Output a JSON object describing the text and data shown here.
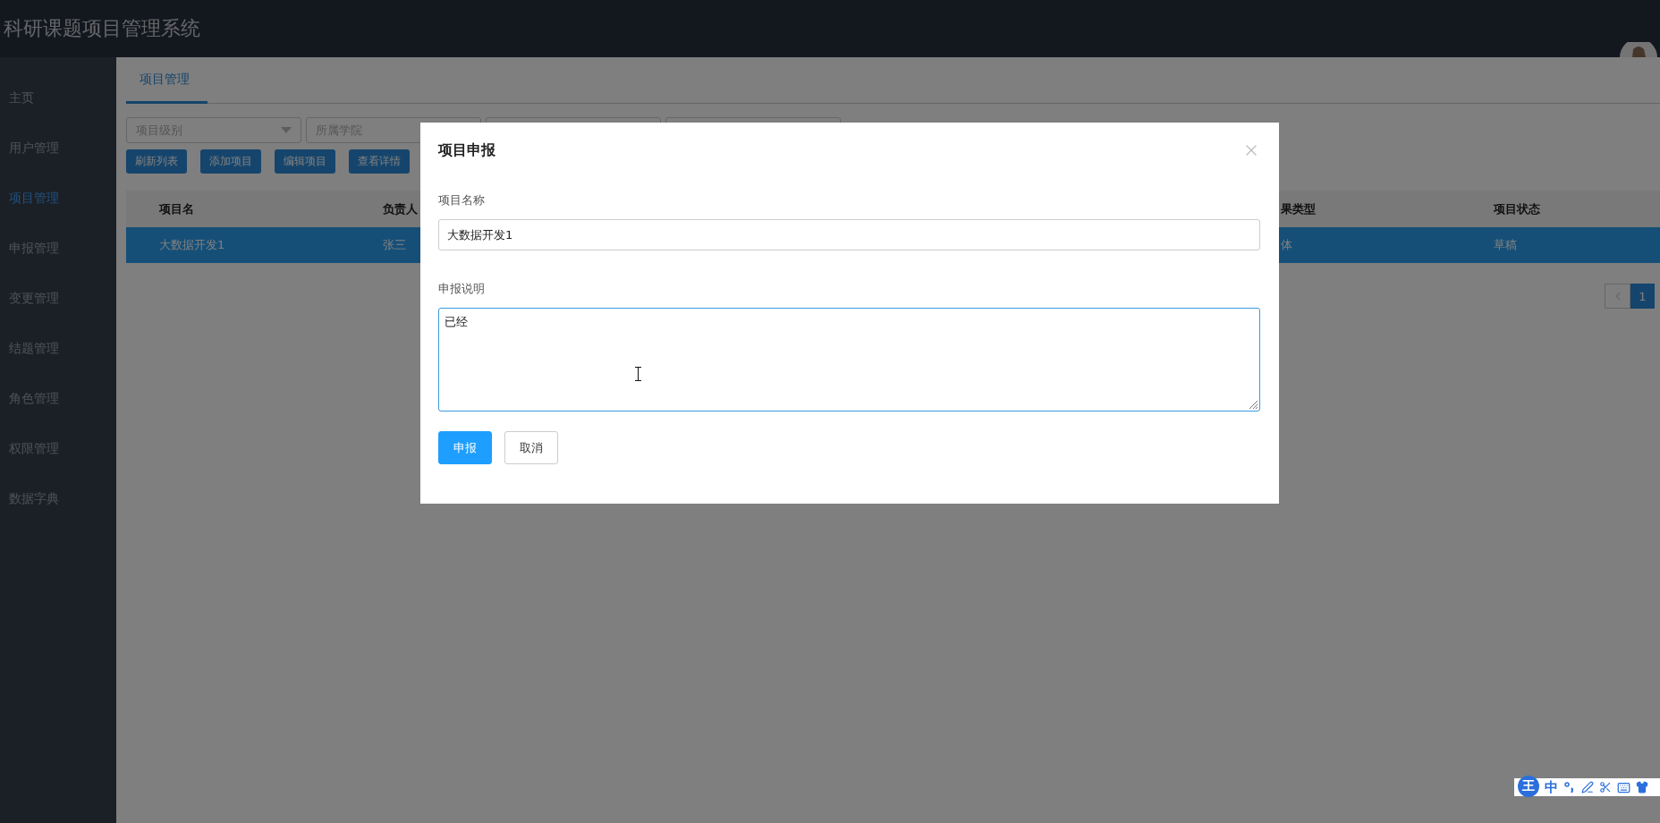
{
  "header": {
    "title": "科研课题项目管理系统"
  },
  "sidebar": {
    "items": [
      {
        "label": "主页",
        "selected": false
      },
      {
        "label": "用户管理",
        "selected": false
      },
      {
        "label": "项目管理",
        "selected": true
      },
      {
        "label": "申报管理",
        "selected": false
      },
      {
        "label": "变更管理",
        "selected": false
      },
      {
        "label": "结题管理",
        "selected": false
      },
      {
        "label": "角色管理",
        "selected": false
      },
      {
        "label": "权限管理",
        "selected": false
      },
      {
        "label": "数据字典",
        "selected": false
      }
    ]
  },
  "tabs": [
    {
      "label": "项目管理",
      "selected": true
    }
  ],
  "filters": [
    {
      "kind": "select",
      "placeholder": "项目级别"
    },
    {
      "kind": "input",
      "placeholder": "所属学院"
    },
    {
      "kind": "input"
    },
    {
      "kind": "input"
    }
  ],
  "toolbar": [
    "刷新列表",
    "添加项目",
    "编辑项目",
    "查看详情"
  ],
  "table": {
    "columns": [
      "项目名",
      "负责人",
      "果类型",
      "项目状态"
    ],
    "rows": [
      {
        "selected": true,
        "cells": [
          "大数据开发1",
          "张三",
          "体",
          "草稿"
        ]
      }
    ]
  },
  "pagination": {
    "pages": [
      {
        "label": "1",
        "selected": true
      }
    ]
  },
  "dialog": {
    "title": "项目申报",
    "fields": [
      {
        "kind": "input",
        "label": "项目名称",
        "value": "大数据开发1",
        "focused": false
      },
      {
        "kind": "textarea",
        "label": "申报说明",
        "value": "已经",
        "focused": true
      }
    ],
    "buttons": [
      {
        "label": "申报",
        "kind": "primary"
      },
      {
        "label": "取消",
        "kind": "default"
      }
    ]
  },
  "ime_toolbar": {
    "logo": "王",
    "mode": "中"
  }
}
